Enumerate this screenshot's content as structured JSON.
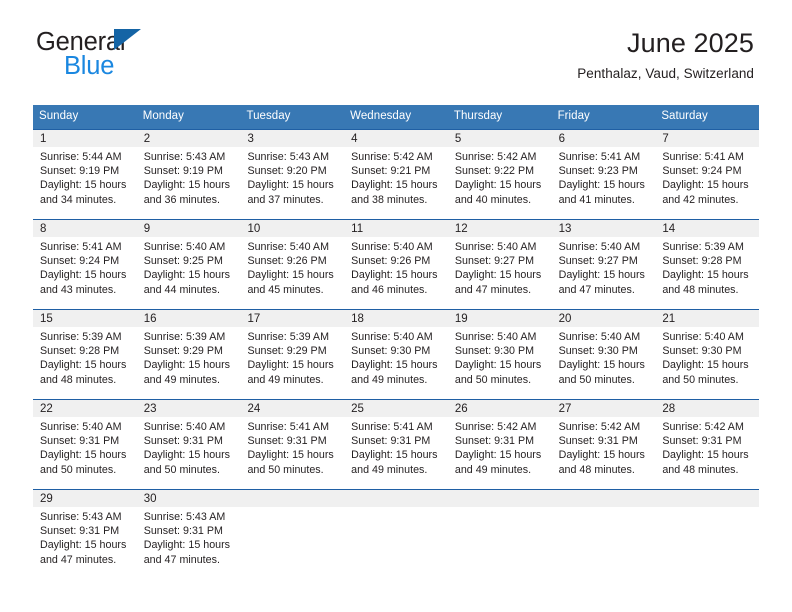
{
  "brand": {
    "name_top": "General",
    "name_bottom": "Blue",
    "triangle_color": "#1464a5",
    "blue_color": "#1a87e0"
  },
  "header": {
    "title": "June 2025",
    "subtitle": "Penthalaz, Vaud, Switzerland"
  },
  "colors": {
    "header_row_bg": "#3878b4",
    "row_separator": "#1f5fa4",
    "day_band_bg": "#f0f0f0",
    "text": "#231f20"
  },
  "weekdays": [
    "Sunday",
    "Monday",
    "Tuesday",
    "Wednesday",
    "Thursday",
    "Friday",
    "Saturday"
  ],
  "weeks": [
    [
      {
        "day": "1",
        "sunrise": "Sunrise: 5:44 AM",
        "sunset": "Sunset: 9:19 PM",
        "daylight1": "Daylight: 15 hours",
        "daylight2": "and 34 minutes."
      },
      {
        "day": "2",
        "sunrise": "Sunrise: 5:43 AM",
        "sunset": "Sunset: 9:19 PM",
        "daylight1": "Daylight: 15 hours",
        "daylight2": "and 36 minutes."
      },
      {
        "day": "3",
        "sunrise": "Sunrise: 5:43 AM",
        "sunset": "Sunset: 9:20 PM",
        "daylight1": "Daylight: 15 hours",
        "daylight2": "and 37 minutes."
      },
      {
        "day": "4",
        "sunrise": "Sunrise: 5:42 AM",
        "sunset": "Sunset: 9:21 PM",
        "daylight1": "Daylight: 15 hours",
        "daylight2": "and 38 minutes."
      },
      {
        "day": "5",
        "sunrise": "Sunrise: 5:42 AM",
        "sunset": "Sunset: 9:22 PM",
        "daylight1": "Daylight: 15 hours",
        "daylight2": "and 40 minutes."
      },
      {
        "day": "6",
        "sunrise": "Sunrise: 5:41 AM",
        "sunset": "Sunset: 9:23 PM",
        "daylight1": "Daylight: 15 hours",
        "daylight2": "and 41 minutes."
      },
      {
        "day": "7",
        "sunrise": "Sunrise: 5:41 AM",
        "sunset": "Sunset: 9:24 PM",
        "daylight1": "Daylight: 15 hours",
        "daylight2": "and 42 minutes."
      }
    ],
    [
      {
        "day": "8",
        "sunrise": "Sunrise: 5:41 AM",
        "sunset": "Sunset: 9:24 PM",
        "daylight1": "Daylight: 15 hours",
        "daylight2": "and 43 minutes."
      },
      {
        "day": "9",
        "sunrise": "Sunrise: 5:40 AM",
        "sunset": "Sunset: 9:25 PM",
        "daylight1": "Daylight: 15 hours",
        "daylight2": "and 44 minutes."
      },
      {
        "day": "10",
        "sunrise": "Sunrise: 5:40 AM",
        "sunset": "Sunset: 9:26 PM",
        "daylight1": "Daylight: 15 hours",
        "daylight2": "and 45 minutes."
      },
      {
        "day": "11",
        "sunrise": "Sunrise: 5:40 AM",
        "sunset": "Sunset: 9:26 PM",
        "daylight1": "Daylight: 15 hours",
        "daylight2": "and 46 minutes."
      },
      {
        "day": "12",
        "sunrise": "Sunrise: 5:40 AM",
        "sunset": "Sunset: 9:27 PM",
        "daylight1": "Daylight: 15 hours",
        "daylight2": "and 47 minutes."
      },
      {
        "day": "13",
        "sunrise": "Sunrise: 5:40 AM",
        "sunset": "Sunset: 9:27 PM",
        "daylight1": "Daylight: 15 hours",
        "daylight2": "and 47 minutes."
      },
      {
        "day": "14",
        "sunrise": "Sunrise: 5:39 AM",
        "sunset": "Sunset: 9:28 PM",
        "daylight1": "Daylight: 15 hours",
        "daylight2": "and 48 minutes."
      }
    ],
    [
      {
        "day": "15",
        "sunrise": "Sunrise: 5:39 AM",
        "sunset": "Sunset: 9:28 PM",
        "daylight1": "Daylight: 15 hours",
        "daylight2": "and 48 minutes."
      },
      {
        "day": "16",
        "sunrise": "Sunrise: 5:39 AM",
        "sunset": "Sunset: 9:29 PM",
        "daylight1": "Daylight: 15 hours",
        "daylight2": "and 49 minutes."
      },
      {
        "day": "17",
        "sunrise": "Sunrise: 5:39 AM",
        "sunset": "Sunset: 9:29 PM",
        "daylight1": "Daylight: 15 hours",
        "daylight2": "and 49 minutes."
      },
      {
        "day": "18",
        "sunrise": "Sunrise: 5:40 AM",
        "sunset": "Sunset: 9:30 PM",
        "daylight1": "Daylight: 15 hours",
        "daylight2": "and 49 minutes."
      },
      {
        "day": "19",
        "sunrise": "Sunrise: 5:40 AM",
        "sunset": "Sunset: 9:30 PM",
        "daylight1": "Daylight: 15 hours",
        "daylight2": "and 50 minutes."
      },
      {
        "day": "20",
        "sunrise": "Sunrise: 5:40 AM",
        "sunset": "Sunset: 9:30 PM",
        "daylight1": "Daylight: 15 hours",
        "daylight2": "and 50 minutes."
      },
      {
        "day": "21",
        "sunrise": "Sunrise: 5:40 AM",
        "sunset": "Sunset: 9:30 PM",
        "daylight1": "Daylight: 15 hours",
        "daylight2": "and 50 minutes."
      }
    ],
    [
      {
        "day": "22",
        "sunrise": "Sunrise: 5:40 AM",
        "sunset": "Sunset: 9:31 PM",
        "daylight1": "Daylight: 15 hours",
        "daylight2": "and 50 minutes."
      },
      {
        "day": "23",
        "sunrise": "Sunrise: 5:40 AM",
        "sunset": "Sunset: 9:31 PM",
        "daylight1": "Daylight: 15 hours",
        "daylight2": "and 50 minutes."
      },
      {
        "day": "24",
        "sunrise": "Sunrise: 5:41 AM",
        "sunset": "Sunset: 9:31 PM",
        "daylight1": "Daylight: 15 hours",
        "daylight2": "and 50 minutes."
      },
      {
        "day": "25",
        "sunrise": "Sunrise: 5:41 AM",
        "sunset": "Sunset: 9:31 PM",
        "daylight1": "Daylight: 15 hours",
        "daylight2": "and 49 minutes."
      },
      {
        "day": "26",
        "sunrise": "Sunrise: 5:42 AM",
        "sunset": "Sunset: 9:31 PM",
        "daylight1": "Daylight: 15 hours",
        "daylight2": "and 49 minutes."
      },
      {
        "day": "27",
        "sunrise": "Sunrise: 5:42 AM",
        "sunset": "Sunset: 9:31 PM",
        "daylight1": "Daylight: 15 hours",
        "daylight2": "and 48 minutes."
      },
      {
        "day": "28",
        "sunrise": "Sunrise: 5:42 AM",
        "sunset": "Sunset: 9:31 PM",
        "daylight1": "Daylight: 15 hours",
        "daylight2": "and 48 minutes."
      }
    ],
    [
      {
        "day": "29",
        "sunrise": "Sunrise: 5:43 AM",
        "sunset": "Sunset: 9:31 PM",
        "daylight1": "Daylight: 15 hours",
        "daylight2": "and 47 minutes."
      },
      {
        "day": "30",
        "sunrise": "Sunrise: 5:43 AM",
        "sunset": "Sunset: 9:31 PM",
        "daylight1": "Daylight: 15 hours",
        "daylight2": "and 47 minutes."
      },
      {
        "day": "",
        "sunrise": "",
        "sunset": "",
        "daylight1": "",
        "daylight2": ""
      },
      {
        "day": "",
        "sunrise": "",
        "sunset": "",
        "daylight1": "",
        "daylight2": ""
      },
      {
        "day": "",
        "sunrise": "",
        "sunset": "",
        "daylight1": "",
        "daylight2": ""
      },
      {
        "day": "",
        "sunrise": "",
        "sunset": "",
        "daylight1": "",
        "daylight2": ""
      },
      {
        "day": "",
        "sunrise": "",
        "sunset": "",
        "daylight1": "",
        "daylight2": ""
      }
    ]
  ]
}
